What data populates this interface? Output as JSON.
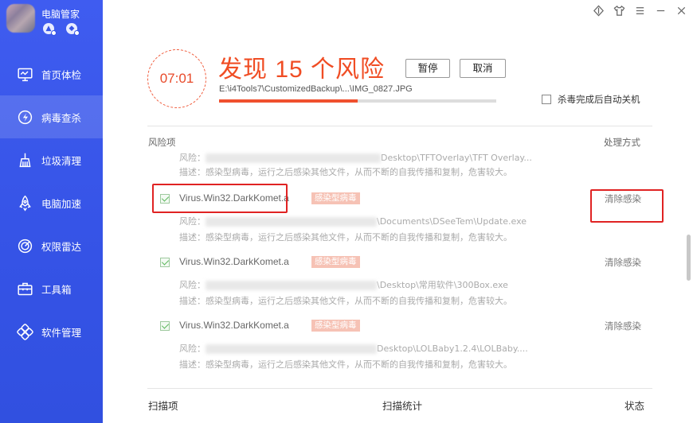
{
  "app": {
    "title": "电脑管家"
  },
  "sidebar": {
    "items": [
      {
        "label": "首页体检",
        "icon": "monitor-icon",
        "active": false
      },
      {
        "label": "病毒查杀",
        "icon": "virus-scan-icon",
        "active": true
      },
      {
        "label": "垃圾清理",
        "icon": "broom-icon",
        "active": false
      },
      {
        "label": "电脑加速",
        "icon": "rocket-icon",
        "active": false
      },
      {
        "label": "权限雷达",
        "icon": "radar-icon",
        "active": false
      },
      {
        "label": "工具箱",
        "icon": "toolbox-icon",
        "active": false
      },
      {
        "label": "软件管理",
        "icon": "apps-icon",
        "active": false
      }
    ]
  },
  "scan": {
    "timer": "07:01",
    "headline": "发现 15 个风险",
    "pause_label": "暂停",
    "cancel_label": "取消",
    "current_path": "E:\\i4Tools7\\CustomizedBackup\\...\\IMG_0827.JPG",
    "progress": 0.5,
    "auto_shutdown_label": "杀毒完成后自动关机",
    "auto_shutdown_checked": false
  },
  "list": {
    "col_risk": "风险项",
    "col_action": "处理方式",
    "partial": {
      "risk_prefix": "风险：",
      "path": "Desktop\\TFTOverlay\\TFT Overlay...",
      "desc": "描述：感染型病毒，运行之后感染其他文件，从而不断的自我传播和复制，危害较大。"
    },
    "entries": [
      {
        "virus": "Virus.Win32.DarkKomet.a",
        "tag": "感染型病毒",
        "action": "清除感染",
        "risk_prefix": "风险：",
        "path": "\\Documents\\DSeeTem\\Update.exe",
        "desc": "描述：感染型病毒，运行之后感染其他文件，从而不断的自我传播和复制，危害较大。"
      },
      {
        "virus": "Virus.Win32.DarkKomet.a",
        "tag": "感染型病毒",
        "action": "清除感染",
        "risk_prefix": "风险：",
        "path": "\\Desktop\\常用软件\\300Box.exe",
        "desc": "描述：感染型病毒，运行之后感染其他文件，从而不断的自我传播和复制，危害较大。"
      },
      {
        "virus": "Virus.Win32.DarkKomet.a",
        "tag": "感染型病毒",
        "action": "清除感染",
        "risk_prefix": "风险：",
        "path": "Desktop\\LOLBaby1.2.4\\LOLBaby....",
        "desc": "描述：感染型病毒，运行之后感染其他文件，从而不断的自我传播和复制，危害较大。"
      }
    ]
  },
  "footer": {
    "col_scan": "扫描项",
    "col_stats": "扫描统计",
    "col_status": "状态"
  },
  "colors": {
    "sidebar": "#3553e6",
    "accent_red": "#f04d24",
    "tag": "#f6c2b5",
    "highlight": "#e02323"
  }
}
